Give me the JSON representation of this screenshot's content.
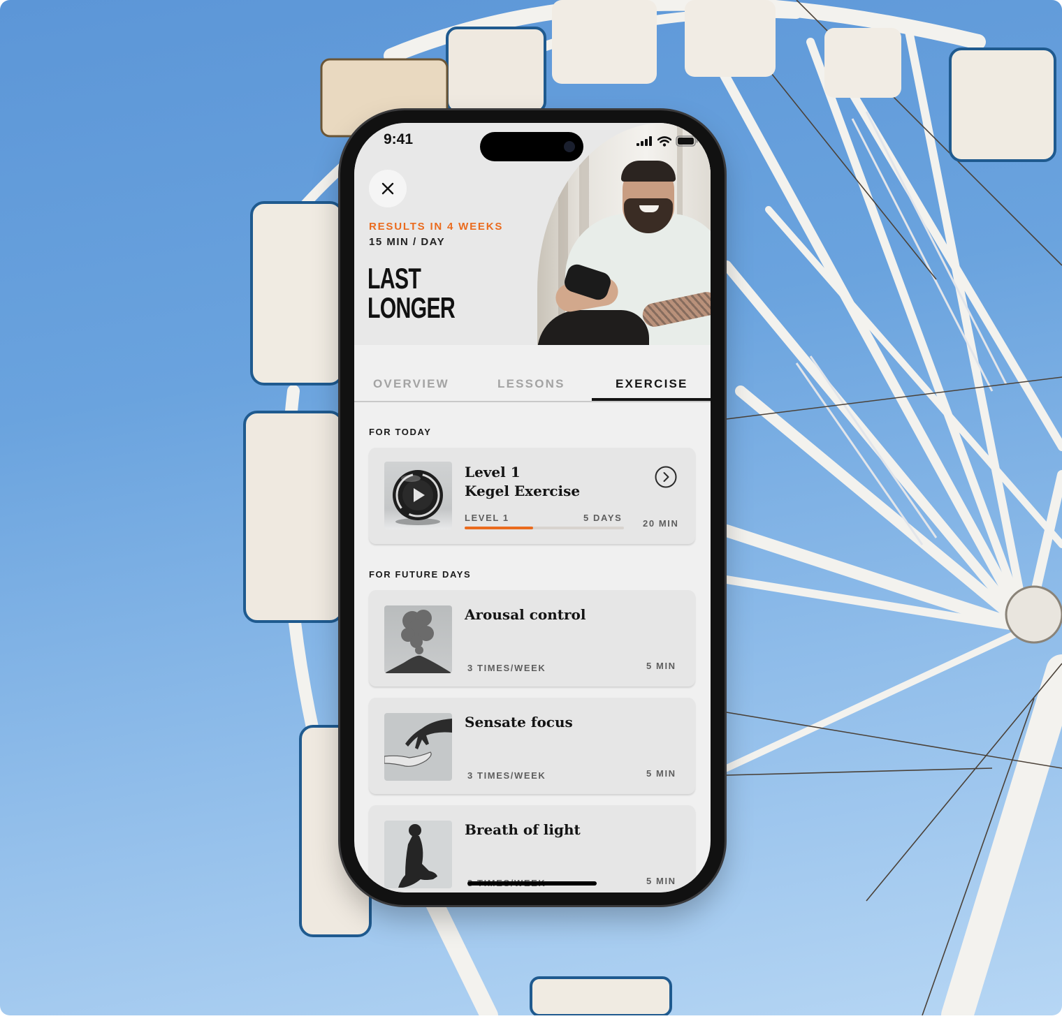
{
  "status_bar": {
    "time": "9:41",
    "icons": [
      "cellular-signal-icon",
      "wifi-icon",
      "battery-icon"
    ]
  },
  "header": {
    "close_icon": "close-icon",
    "kicker": "RESULTS IN 4 WEEKS",
    "subtitle": "15 MIN / DAY",
    "title_line1": "LAST",
    "title_line2": "LONGER"
  },
  "tabs": [
    {
      "label": "OVERVIEW",
      "active": false
    },
    {
      "label": "LESSONS",
      "active": false
    },
    {
      "label": "EXERCISE",
      "active": true
    }
  ],
  "today": {
    "section_label": "FOR TODAY",
    "card": {
      "title_line1": "Level 1",
      "title_line2": "Kegel Exercise",
      "level_label": "LEVEL 1",
      "days_label": "5 DAYS",
      "duration": "20 MIN",
      "progress": 0.43,
      "thumb_icon": "play-icon",
      "action_icon": "chevron-right-circle-icon"
    }
  },
  "future": {
    "section_label": "FOR FUTURE DAYS",
    "cards": [
      {
        "title": "Arousal control",
        "frequency": "3 TIMES/WEEK",
        "duration": "5 MIN",
        "thumb": "volcano-image"
      },
      {
        "title": "Sensate focus",
        "frequency": "3 TIMES/WEEK",
        "duration": "5 MIN",
        "thumb": "hands-image"
      },
      {
        "title": "Breath of light",
        "frequency": "3 TIMES/WEEK",
        "duration": "5 MIN",
        "thumb": "meditation-image"
      }
    ]
  },
  "colors": {
    "accent": "#ea6b1e",
    "text": "#141414",
    "muted": "#a3a3a3",
    "sky_top": "#5c96d7",
    "sky_bottom": "#b6d6f4"
  }
}
